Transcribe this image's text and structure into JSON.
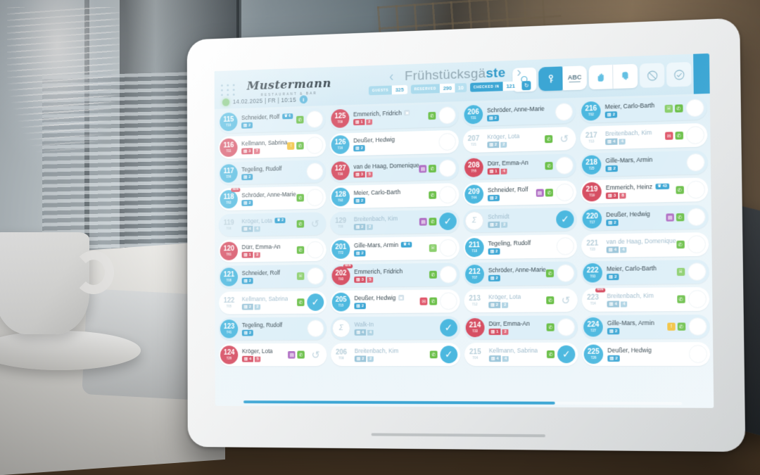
{
  "app": {
    "brand_name": "Mustermann",
    "brand_sub": "RESTAURANT & BAR",
    "datetime": "14.02.2025 | FR | 10:15",
    "info_label": "i",
    "title_prefix": "Frühstücksgä",
    "title_accent": "ste",
    "prev_label": "‹",
    "next_label": "›"
  },
  "stats": [
    {
      "key": "GUESTS",
      "value": "325"
    },
    {
      "key": "RESERVED",
      "value": "290",
      "value2": "10"
    },
    {
      "key": "CHECKED IN",
      "value": "121",
      "highlight": true
    }
  ],
  "refresh_label": "↻",
  "toolbar": [
    {
      "name": "search-icon",
      "label": "search",
      "active": false
    },
    {
      "name": "key-icon",
      "label": "key",
      "active": true
    },
    {
      "name": "abc-sort-icon",
      "label": "ABC",
      "active": false
    },
    {
      "name": "hand-up-icon",
      "label": "hand-up",
      "active": false
    },
    {
      "name": "hand-down-icon",
      "label": "hand-down",
      "active": false
    },
    {
      "name": "no-entry-icon",
      "label": "no-entry",
      "active": false
    },
    {
      "name": "check-circle-icon",
      "label": "confirm",
      "active": false
    }
  ],
  "collapse_label": "‹",
  "colors": {
    "accent": "#3ca6d4",
    "blue": "#4cb8df",
    "red": "#d64f63",
    "green": "#6cc04a",
    "purple": "#b06fc4",
    "yellow": "#f2c23e",
    "tinted_row": "#ddeff8"
  },
  "columns": [
    {
      "cards": [
        {
          "num": "115",
          "sub": "T10",
          "color": "blue",
          "name": "Schneider, Rolf",
          "pax": [
            "2"
          ],
          "paxColor": "blue",
          "crown": "6",
          "tags": [
            "green"
          ],
          "state": "empty",
          "tinted": true
        },
        {
          "num": "116",
          "sub": "T11",
          "color": "red",
          "name": "Kellmann, Sabrina",
          "pax": [
            "3",
            "7"
          ],
          "paxColor": "red",
          "tags": [
            "yellow",
            "green"
          ],
          "state": "empty",
          "tinted": false
        },
        {
          "num": "117",
          "sub": "T50",
          "color": "blue",
          "name": "Tegeling, Rudolf",
          "pax": [
            "2"
          ],
          "paxColor": "blue",
          "tags": [],
          "state": "empty",
          "tinted": true
        },
        {
          "num": "118",
          "sub": "T62",
          "color": "blue",
          "name": "Schröder, Anne-Marie",
          "pax": [
            "2"
          ],
          "paxColor": "blue",
          "tags": [
            "green"
          ],
          "state": "empty",
          "tinted": false,
          "new": "NEW"
        },
        {
          "num": "119",
          "sub": "T06",
          "color": "muted",
          "name": "Kröger, Lota",
          "pax": [
            "4",
            "4"
          ],
          "paxColor": "blue",
          "crown": "2",
          "tags": [
            "green"
          ],
          "state": "pending",
          "tinted": true,
          "muted": true
        },
        {
          "num": "120",
          "sub": "T61",
          "color": "red",
          "name": "Dürr, Emma-An",
          "pax": [
            "1",
            "2"
          ],
          "paxColor": "red",
          "tags": [
            "green"
          ],
          "state": "empty",
          "tinted": false
        },
        {
          "num": "121",
          "sub": "T08",
          "color": "blue",
          "name": "Schneider, Rolf",
          "pax": [
            "2"
          ],
          "paxColor": "blue",
          "tags": [
            "greenlt"
          ],
          "state": "empty",
          "tinted": true
        },
        {
          "num": "122",
          "sub": "T05",
          "color": "muted",
          "name": "Kellmann, Sabrina",
          "pax": [
            "2",
            "2"
          ],
          "paxColor": "blue",
          "tags": [
            "green"
          ],
          "state": "check",
          "tinted": false,
          "muted": true
        },
        {
          "num": "123",
          "sub": "T41",
          "color": "blue",
          "name": "Tegeling, Rudolf",
          "pax": [
            "2"
          ],
          "paxColor": "blue",
          "tags": [],
          "state": "empty",
          "tinted": true
        },
        {
          "num": "124",
          "sub": "T20",
          "color": "red",
          "name": "Kröger, Lota",
          "pax": [
            "4",
            "5"
          ],
          "paxColor": "red",
          "tags": [
            "purple",
            "green"
          ],
          "state": "pending",
          "tinted": false
        }
      ]
    },
    {
      "cards": [
        {
          "num": "125",
          "sub": "T09",
          "color": "red",
          "name": "Emmerich, Fridrich",
          "pax": [
            "1",
            "2"
          ],
          "paxColor": "red",
          "photo": true,
          "tags": [
            "green"
          ],
          "state": "empty",
          "tinted": true
        },
        {
          "num": "126",
          "sub": "T16",
          "color": "blue",
          "name": "Deußer, Hedwig",
          "pax": [
            "2"
          ],
          "paxColor": "blue",
          "tags": [],
          "state": "empty",
          "tinted": false
        },
        {
          "num": "127",
          "sub": "T30",
          "color": "red",
          "name": "van de Haag, Domenique",
          "pax": [
            "3",
            "5"
          ],
          "paxColor": "red",
          "tags": [
            "purple",
            "green"
          ],
          "state": "empty",
          "tinted": true
        },
        {
          "num": "128",
          "sub": "T92",
          "color": "blue",
          "name": "Meier, Carlo-Barth",
          "pax": [
            "2"
          ],
          "paxColor": "blue",
          "tags": [
            "green"
          ],
          "state": "empty",
          "tinted": false
        },
        {
          "num": "129",
          "sub": "T00",
          "color": "muted",
          "name": "Breitenbach, Kim",
          "pax": [
            "2",
            "2"
          ],
          "paxColor": "blue",
          "tags": [
            "purple",
            "green"
          ],
          "state": "check",
          "tinted": true,
          "muted": true
        },
        {
          "num": "201",
          "sub": "T72",
          "color": "blue",
          "name": "Gille-Mars, Armin",
          "pax": [
            "2"
          ],
          "paxColor": "blue",
          "crown": "4",
          "tags": [
            "greenlt"
          ],
          "state": "empty",
          "tinted": false
        },
        {
          "num": "202",
          "sub": "T93",
          "color": "red",
          "name": "Emmerich, Fridrich",
          "pax": [
            "3",
            "5"
          ],
          "paxColor": "red",
          "tags": [
            "green"
          ],
          "state": "empty",
          "tinted": true,
          "new": "NEW"
        },
        {
          "num": "205",
          "sub": "T15",
          "color": "blue",
          "name": "Deußer, Hedwig",
          "pax": [
            "2"
          ],
          "paxColor": "blue",
          "photo": true,
          "tags": [
            "red",
            "green"
          ],
          "state": "empty",
          "tinted": false
        },
        {
          "num": "",
          "sub": "",
          "color": "walkin",
          "name": "Walk-In",
          "pax": [
            "4",
            "4"
          ],
          "paxColor": "blue",
          "tags": [],
          "state": "check",
          "tinted": true,
          "muted": true
        },
        {
          "num": "206",
          "sub": "T09",
          "color": "muted",
          "name": "Breitenbach, Kim",
          "pax": [
            "2",
            "2"
          ],
          "paxColor": "blue",
          "tags": [
            "green"
          ],
          "state": "check",
          "tinted": false,
          "muted": true
        }
      ]
    },
    {
      "cards": [
        {
          "num": "206",
          "sub": "T31",
          "color": "blue",
          "name": "Schröder, Anne-Marie",
          "pax": [
            "2"
          ],
          "paxColor": "blue",
          "tags": [],
          "state": "empty",
          "tinted": true
        },
        {
          "num": "207",
          "sub": "T21",
          "color": "muted",
          "name": "Kröger, Lota",
          "pax": [
            "2",
            "2"
          ],
          "paxColor": "blue",
          "tags": [
            "green"
          ],
          "state": "pending",
          "tinted": false,
          "muted": true
        },
        {
          "num": "208",
          "sub": "T55",
          "color": "red",
          "name": "Dürr, Emma-An",
          "pax": [
            "1",
            "4"
          ],
          "paxColor": "red",
          "tags": [
            "green"
          ],
          "state": "empty",
          "tinted": true
        },
        {
          "num": "209",
          "sub": "T44",
          "color": "blue",
          "name": "Schneider, Rolf",
          "pax": [
            "2"
          ],
          "paxColor": "blue",
          "tags": [
            "purple",
            "green"
          ],
          "state": "empty",
          "tinted": false
        },
        {
          "num": "",
          "sub": "",
          "color": "walkin",
          "name": "Schmidt",
          "pax": [
            "2",
            "2"
          ],
          "paxColor": "blue",
          "tags": [],
          "state": "check",
          "tinted": true,
          "muted": true
        },
        {
          "num": "211",
          "sub": "T18",
          "color": "blue",
          "name": "Tegeling, Rudolf",
          "pax": [
            "2"
          ],
          "paxColor": "blue",
          "tags": [],
          "state": "empty",
          "tinted": false
        },
        {
          "num": "212",
          "sub": "T07",
          "color": "blue",
          "name": "Schröder, Anne-Marie",
          "pax": [
            "2"
          ],
          "paxColor": "blue",
          "tags": [
            "green"
          ],
          "state": "empty",
          "tinted": true
        },
        {
          "num": "213",
          "sub": "T12",
          "color": "muted",
          "name": "Kröger, Lota",
          "pax": [
            "2",
            "2"
          ],
          "paxColor": "blue",
          "tags": [
            "green"
          ],
          "state": "pending",
          "tinted": false,
          "muted": true
        },
        {
          "num": "214",
          "sub": "T33",
          "color": "red",
          "name": "Dürr, Emma-An",
          "pax": [
            "1",
            "2"
          ],
          "paxColor": "red",
          "tags": [
            "green"
          ],
          "state": "empty",
          "tinted": true
        },
        {
          "num": "215",
          "sub": "T04",
          "color": "muted",
          "name": "Kellmann, Sabrina",
          "pax": [
            "4",
            "4"
          ],
          "paxColor": "blue",
          "tags": [
            "green"
          ],
          "state": "check",
          "tinted": false,
          "muted": true
        }
      ]
    },
    {
      "cards": [
        {
          "num": "216",
          "sub": "T02",
          "color": "blue",
          "name": "Meier, Carlo-Barth",
          "pax": [
            "2"
          ],
          "paxColor": "blue",
          "tags": [
            "greenlt",
            "green"
          ],
          "state": "empty",
          "tinted": true
        },
        {
          "num": "217",
          "sub": "T13",
          "color": "muted",
          "name": "Breitenbach, Kim",
          "pax": [
            "4",
            "4"
          ],
          "paxColor": "blue",
          "tags": [
            "red",
            "green"
          ],
          "state": "empty",
          "tinted": false,
          "muted": true
        },
        {
          "num": "218",
          "sub": "T25",
          "color": "blue",
          "name": "Gille-Mars, Armin",
          "pax": [
            "2"
          ],
          "paxColor": "blue",
          "tags": [],
          "state": "empty",
          "tinted": true
        },
        {
          "num": "219",
          "sub": "T19",
          "color": "red",
          "name": "Emmerich, Heinz",
          "pax": [
            "3",
            "8"
          ],
          "paxColor": "red",
          "crown": "43",
          "tags": [
            "green"
          ],
          "state": "empty",
          "tinted": false
        },
        {
          "num": "220",
          "sub": "T17",
          "color": "blue",
          "name": "Deußer, Hedwig",
          "pax": [
            "2"
          ],
          "paxColor": "blue",
          "tags": [
            "purple",
            "green"
          ],
          "state": "empty",
          "tinted": true
        },
        {
          "num": "221",
          "sub": "T23",
          "color": "muted",
          "name": "van de Haag, Domenique",
          "pax": [
            "4",
            "4"
          ],
          "paxColor": "blue",
          "tags": [
            "green"
          ],
          "state": "empty",
          "tinted": false,
          "muted": true
        },
        {
          "num": "222",
          "sub": "T03",
          "color": "blue",
          "name": "Meier, Carlo-Barth",
          "pax": [
            "2"
          ],
          "paxColor": "blue",
          "tags": [
            "greenlt"
          ],
          "state": "empty",
          "tinted": true
        },
        {
          "num": "223",
          "sub": "T14",
          "color": "muted",
          "name": "Breitenbach, Kim",
          "pax": [
            "4",
            "4"
          ],
          "paxColor": "blue",
          "tags": [
            "green"
          ],
          "state": "empty",
          "tinted": false,
          "muted": true,
          "new": "NEW"
        },
        {
          "num": "224",
          "sub": "T27",
          "color": "blue",
          "name": "Gille-Mars, Armin",
          "pax": [
            "2"
          ],
          "paxColor": "blue",
          "tags": [
            "yellow",
            "green"
          ],
          "state": "empty",
          "tinted": true
        },
        {
          "num": "225",
          "sub": "T26",
          "color": "blue",
          "name": "Deußer, Hedwig",
          "pax": [
            "2"
          ],
          "paxColor": "blue",
          "tags": [],
          "state": "empty",
          "tinted": false
        }
      ]
    }
  ]
}
